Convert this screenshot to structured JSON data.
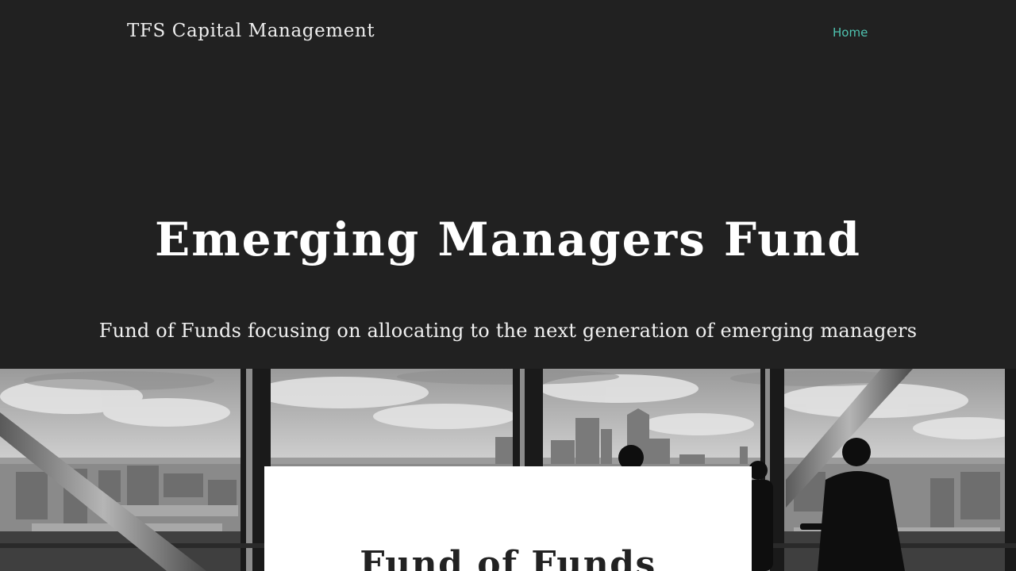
{
  "header": {
    "brand": "TFS Capital Management",
    "nav": {
      "home_label": "Home"
    }
  },
  "hero": {
    "title": "Emerging Managers Fund",
    "subtitle": "Fund of Funds focusing on allocating to the next generation of emerging managers"
  },
  "card": {
    "title": "Fund of Funds"
  },
  "colors": {
    "background": "#212121",
    "nav_accent": "#4fc3b0",
    "heading": "#ffffff",
    "card_background": "#ffffff"
  }
}
